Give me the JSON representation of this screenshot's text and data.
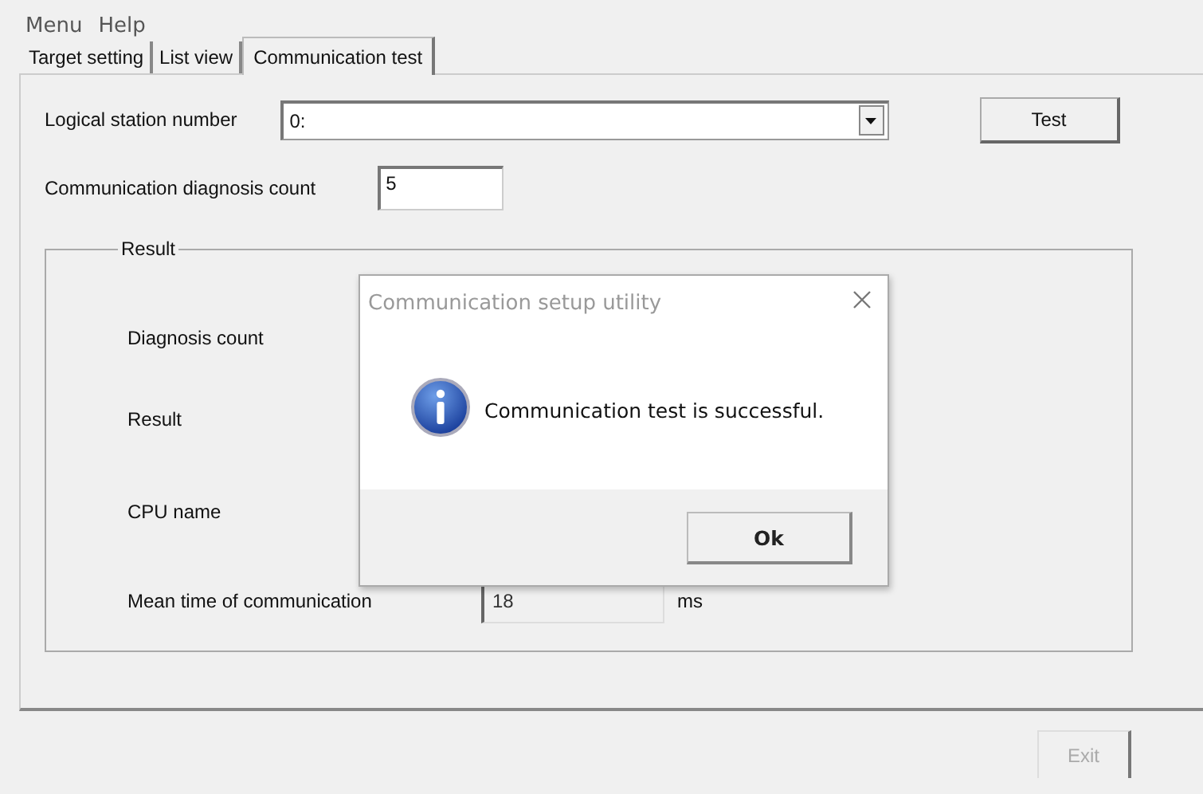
{
  "menu": [
    {
      "label": "Menu"
    },
    {
      "label": "Help"
    }
  ],
  "tabs": [
    {
      "label": "Target setting",
      "selected": false
    },
    {
      "label": "List view",
      "selected": false
    },
    {
      "label": "Communication test",
      "selected": true
    }
  ],
  "form": {
    "logical_station_number": {
      "label": "Logical station number",
      "value": "0:"
    },
    "diagnosis_count": {
      "label": "Communication diagnosis count",
      "value": "5"
    },
    "test_button": "Test"
  },
  "result_group": {
    "title": "Result",
    "rows": [
      {
        "label": "Diagnosis count"
      },
      {
        "label": "Result"
      },
      {
        "label": "CPU name"
      },
      {
        "label": "Mean time of communication",
        "value": "18",
        "unit": "ms"
      }
    ]
  },
  "exit_button": {
    "label": "Exit",
    "disabled": true
  },
  "dialog": {
    "title": "Communication setup utility",
    "message": "Communication test is successful.",
    "ok_button": "Ok"
  }
}
